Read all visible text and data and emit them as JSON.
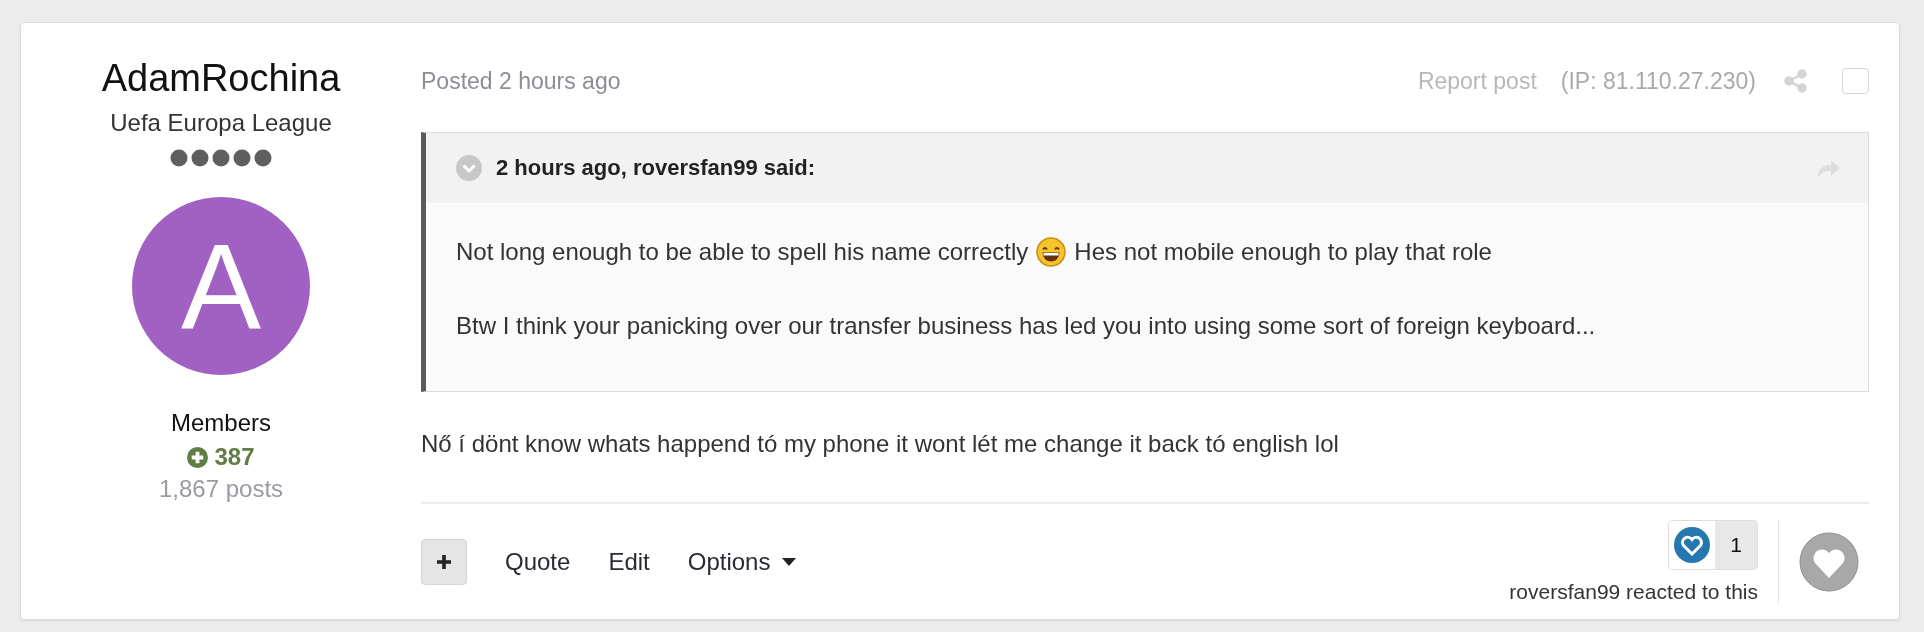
{
  "author": {
    "name": "AdamRochina",
    "rank": "Uefa Europa League",
    "avatar_letter": "A",
    "group": "Members",
    "reputation": "387",
    "posts": "1,867 posts"
  },
  "post": {
    "posted": "Posted 2 hours ago",
    "report": "Report post",
    "ip": "(IP: 81.110.27.230)",
    "selected": false,
    "quote": {
      "citation": "2 hours ago, roversfan99 said:",
      "lines": [
        "Not long enough to be able to spell his name correctly",
        "Hes not mobile enough to play that role"
      ],
      "paragraph_2": "Btw I think your panicking over our transfer business has led you into using some sort of foreign keyboard..."
    },
    "body": "Nő í dönt know whats happend tó my phone it wont lét me change it back tó english lol"
  },
  "actions": [
    "Quote",
    "Edit",
    "Options"
  ],
  "reactions": {
    "count": "1",
    "summary": "roversfan99 reacted to this"
  }
}
